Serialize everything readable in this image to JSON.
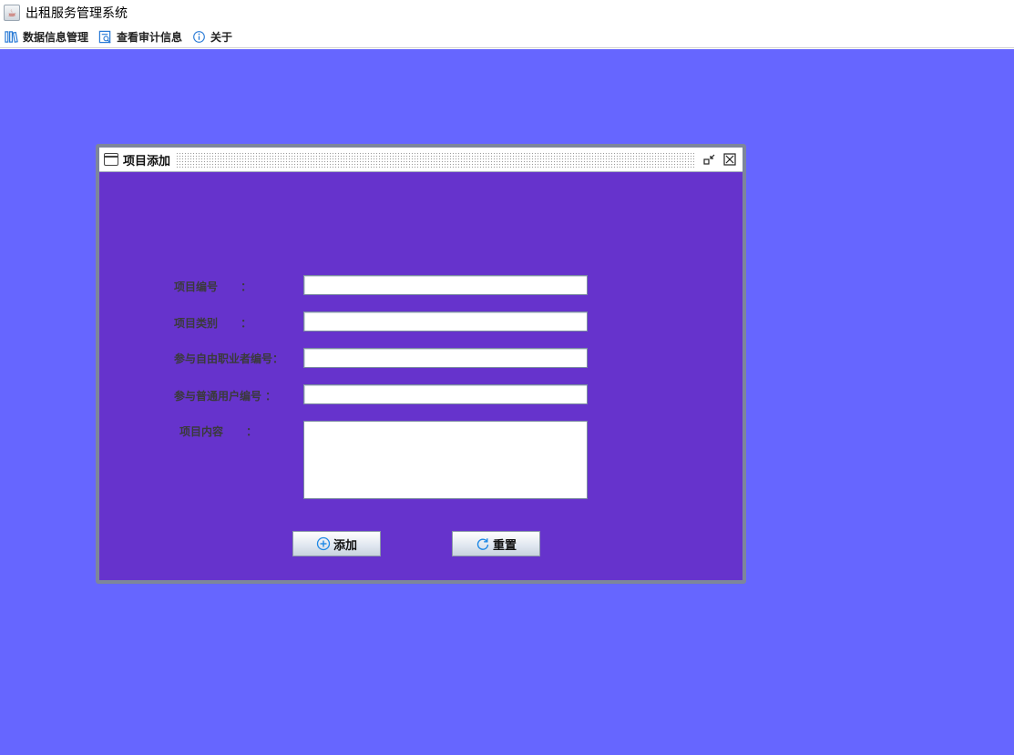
{
  "app": {
    "title": "出租服务管理系统"
  },
  "menu": {
    "items": [
      {
        "label": "数据信息管理",
        "icon": "data-manage-icon"
      },
      {
        "label": "查看审计信息",
        "icon": "audit-view-icon"
      },
      {
        "label": "关于",
        "icon": "info-icon"
      }
    ]
  },
  "frame": {
    "title": "项目添加",
    "form": {
      "labels": {
        "project_id": "项目编号      ：",
        "project_type": "项目类别      ：",
        "freelancer_id": "参与自由职业者编号：",
        "user_id": "参与普通用户编号 ：",
        "content": "项目内容      ："
      },
      "values": {
        "project_id": "",
        "project_type": "",
        "freelancer_id": "",
        "user_id": "",
        "content": ""
      }
    },
    "buttons": {
      "add": "添加",
      "reset": "重置"
    }
  },
  "colors": {
    "desktop": "#6666ff",
    "frame_body": "#6633cc",
    "frame_border": "#7d869b"
  }
}
